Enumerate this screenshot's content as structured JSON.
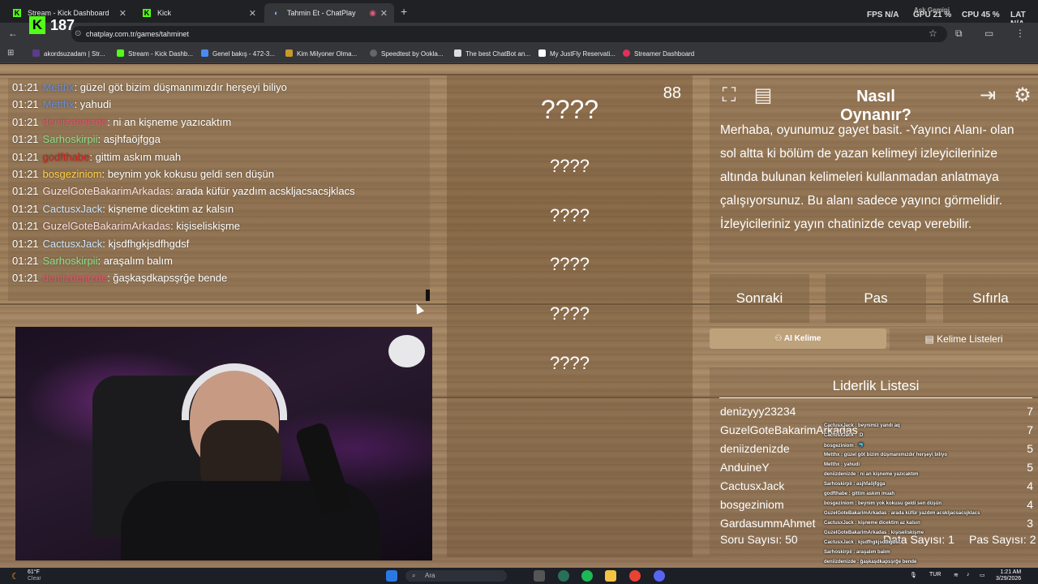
{
  "browser": {
    "tabs": [
      {
        "label": "Stream - Kick Dashboard",
        "active": false
      },
      {
        "label": "Kick",
        "active": false
      },
      {
        "label": "Tahmin Et - ChatPlay",
        "active": true
      }
    ],
    "url": "chatplay.com.tr/games/tahminet",
    "perf": {
      "fps": "FPS N/A",
      "gpu": "GPU 21 %",
      "cpu": "CPU 45 %",
      "lat": "LAT N/A",
      "ask": "Ask Gemini"
    },
    "kick_viewers": "187",
    "bookmarks": [
      "akordsuzadam | Str...",
      "Stream - Kick Dashb...",
      "Genel bakış - 472-3...",
      "Kim Milyoner Olma...",
      "Speedtest by Ookla...",
      "The best ChatBot an...",
      "My JustFly Reservati...",
      "Streamer Dashboard"
    ]
  },
  "chat": {
    "messages": [
      {
        "time": "01:21",
        "user": "Metthx",
        "color": "#6b8ed6",
        "text": ": güzel göt bizim düşmanımızdır herşeyi biliyo"
      },
      {
        "time": "01:21",
        "user": "Metthx",
        "color": "#6b8ed6",
        "text": ": yahudi"
      },
      {
        "time": "01:21",
        "user": "deniizdenizde",
        "color": "#e0566b",
        "text": ": ni an kişneme yazıcaktım"
      },
      {
        "time": "01:21",
        "user": "Sarhoskirpii",
        "color": "#8be08b",
        "text": ": asjhfaöjfgga"
      },
      {
        "time": "01:21",
        "user": "godfthabe",
        "color": "#d41c1c",
        "text": ": gittim askım muah"
      },
      {
        "time": "01:21",
        "user": "bosgeziniom",
        "color": "#ffd24a",
        "text": ": beynim yok kokusu geldi sen düşün"
      },
      {
        "time": "01:21",
        "user": "GuzelGoteBakarimArkadas",
        "color": "#ffe0e0",
        "text": ": arada küfür yazdım acskljacsacsjklacs"
      },
      {
        "time": "01:21",
        "user": "CactusxJack",
        "color": "#cde6ff",
        "text": ": kişneme dicektim az kalsın"
      },
      {
        "time": "01:21",
        "user": "GuzelGoteBakarimArkadas",
        "color": "#ffe0e0",
        "text": ": kişiseliskişme"
      },
      {
        "time": "01:21",
        "user": "CactusxJack",
        "color": "#cde6ff",
        "text": ": kjsdfhgkjsdfhgdsf"
      },
      {
        "time": "01:21",
        "user": "Sarhoskirpii",
        "color": "#8be08b",
        "text": ": araşalım balım"
      },
      {
        "time": "01:21",
        "user": "deniizdenizde",
        "color": "#e0566b",
        "text": ": ğaşkaşdkapsşrğe bende"
      }
    ]
  },
  "game": {
    "timer": "88",
    "words": [
      "????",
      "????",
      "????",
      "????",
      "????",
      "????"
    ],
    "how_to_play_title": "Nasıl Oynanır?",
    "how_to_play_text": "Merhaba, oyunumuz gayet basit. -Yayıncı Alanı- olan sol altta ki bölüm de yazan kelimeyi izleyicilerinize altında bulunan kelimeleri kullanmadan anlatmaya çalışıyorsunuz. Bu alanı sadece yayıncı görmelidir. İzleyicileriniz yayın chatinizde cevap verebilir.",
    "buttons": {
      "next": "Sonraki",
      "pass": "Pas",
      "reset": "Sıfırla"
    },
    "tabs": {
      "ai": "AI Kelime",
      "lists": "Kelime Listeleri"
    }
  },
  "leaderboard": {
    "title": "Liderlik Listesi",
    "rows": [
      {
        "name": "denizyyy23234",
        "score": "7"
      },
      {
        "name": "GuzelGoteBakarimArkadas",
        "score": "7"
      },
      {
        "name": "deniizdenizde",
        "score": "5"
      },
      {
        "name": "AnduineY",
        "score": "5"
      },
      {
        "name": "CactusxJack",
        "score": "4"
      },
      {
        "name": "bosgeziniom",
        "score": "4"
      },
      {
        "name": "GardasummAhmet",
        "score": "3"
      }
    ],
    "question_count": "Soru Sayısı: 50",
    "data_count": "Data Sayısı: 1",
    "pass_count": "Pas Sayısı: 2"
  },
  "mini_chat": [
    "CactusxJack : beynimiz yandı aq",
    "CactusxJack : :D",
    "bosgeziniom : 🐬",
    "Metthx : güzel göt bizim düşmanımızdır herşeyi biliyo",
    "Metthx : yahudi",
    "deniizdenizde : ni an kişneme yazıcaktım",
    "Sarhoskirpii : asjhfaöjfgga",
    "godfthabe : gittim askım muah",
    "bosgeziniom : beynim yok kokusu geldi sen düşün",
    "GuzelGoteBakarimArkadas : arada küfür yazdım acskljacsacsjklacs",
    "CactusxJack : kişneme dicektim az kalsın",
    "GuzelGoteBakarimArkadas : kişiseliskişme",
    "CactusxJack : kjsdfhgkjsdfhgdsf",
    "Sarhoskirpii : araşalım balım",
    "deniizdenizde : ğaşkaşdkapsşrğe bende"
  ],
  "taskbar": {
    "weather_temp": "61°F",
    "weather_desc": "Clear",
    "search": "Ara",
    "lang": "TUR",
    "time": "1:21 AM",
    "date": "3/29/2026"
  }
}
